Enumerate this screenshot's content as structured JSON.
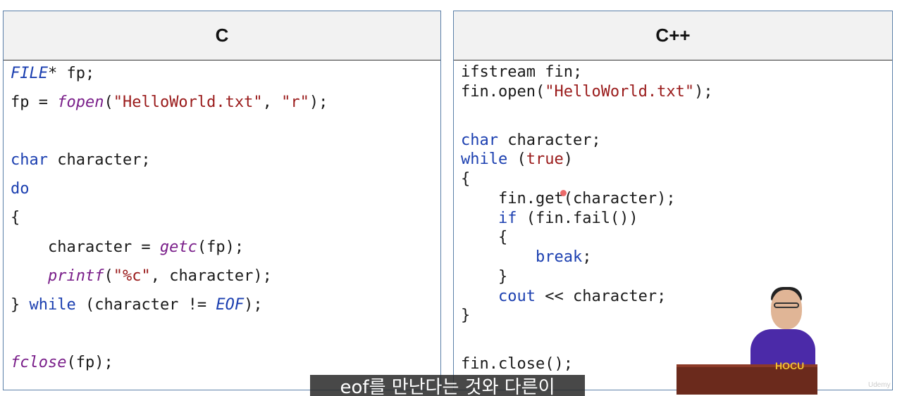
{
  "c_panel": {
    "title": "C",
    "lines": {
      "l1": {
        "a": "FILE",
        "b": "* fp;"
      },
      "l2": {
        "a": "fp = ",
        "b": "fopen",
        "c": "(",
        "d": "\"HelloWorld.txt\"",
        "e": ", ",
        "f": "\"r\"",
        "g": ");"
      },
      "l3": {
        "a": "char",
        "b": " character;"
      },
      "l4": {
        "a": "do"
      },
      "l5": {
        "a": "{"
      },
      "l6": {
        "a": "    character = ",
        "b": "getc",
        "c": "(fp);"
      },
      "l7": {
        "a": "    ",
        "b": "printf",
        "c": "(",
        "d": "\"%c\"",
        "e": ", character);"
      },
      "l8": {
        "a": "} ",
        "b": "while",
        "c": " (character != ",
        "d": "EOF",
        "e": ");"
      },
      "l9": {
        "a": "fclose",
        "b": "(fp);"
      }
    }
  },
  "cpp_panel": {
    "title": "C++",
    "lines": {
      "l1": {
        "a": "ifstream fin;"
      },
      "l2": {
        "a": "fin.open(",
        "b": "\"HelloWorld.txt\"",
        "c": ");"
      },
      "l3": {
        "a": "char",
        "b": " character;"
      },
      "l4": {
        "a": "while",
        "b": " (",
        "c": "true",
        "d": ")"
      },
      "l5": {
        "a": "{"
      },
      "l6": {
        "a": "    fin.get(character);"
      },
      "l7": {
        "a": "    ",
        "b": "if",
        "c": " (fin.fail())"
      },
      "l8": {
        "a": "    {"
      },
      "l9": {
        "a": "        ",
        "b": "break",
        "c": ";"
      },
      "l10": {
        "a": "    }"
      },
      "l11": {
        "a": "    ",
        "b": "cout",
        "c": " << character;"
      },
      "l12": {
        "a": "}"
      },
      "l13": {
        "a": "fin.close();"
      }
    }
  },
  "overlay": {
    "subtitle": "eof를 만난다는 것와 다른이",
    "watermark": "Udemy",
    "presenter_shirt_logo": "HOCU"
  },
  "colors": {
    "keyword": "#1b3fb0",
    "function": "#7a1f8a",
    "string": "#9a1b1b",
    "border": "#5b7fa8",
    "header_bg": "#f2f2f2"
  }
}
